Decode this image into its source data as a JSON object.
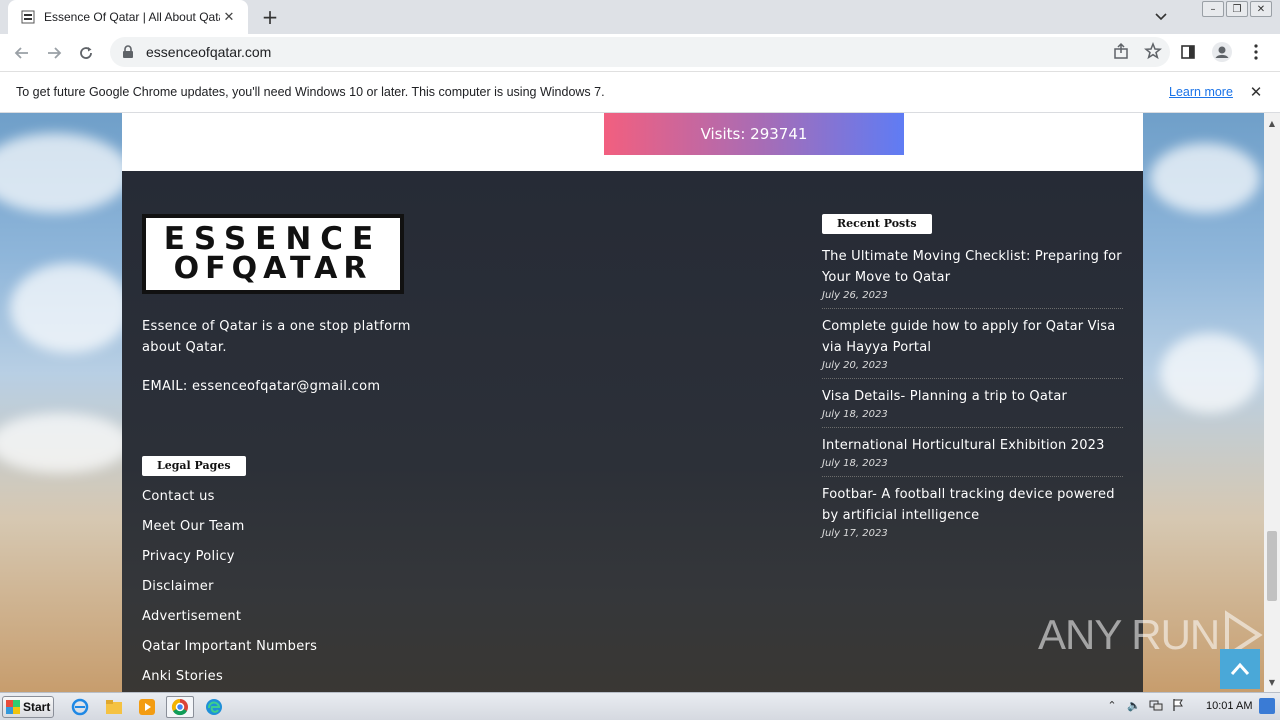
{
  "browser": {
    "tab_title": "Essence Of Qatar | All About Qatar",
    "url": "essenceofqatar.com",
    "infobar_text": "To get future Google Chrome updates, you'll need Windows 10 or later. This computer is using Windows 7.",
    "infobar_link": "Learn more"
  },
  "page": {
    "visits": "Visits: 293741",
    "footer": {
      "logo_line1": "ESSENCE",
      "logo_line2": "OFQATAR",
      "about": "Essence of Qatar is a one stop platform about Qatar.",
      "email": "EMAIL: essenceofqatar@gmail.com",
      "legal_title": "Legal Pages",
      "legal_links": [
        "Contact us",
        "Meet Our Team",
        "Privacy Policy",
        "Disclaimer",
        "Advertisement",
        "Qatar Important Numbers",
        "Anki Stories"
      ],
      "recent_title": "Recent Posts",
      "recent_posts": [
        {
          "title": "The Ultimate Moving Checklist: Preparing for Your Move to Qatar",
          "date": "July 26, 2023"
        },
        {
          "title": "Complete guide how to apply for Qatar Visa via Hayya Portal",
          "date": "July 20, 2023"
        },
        {
          "title": "Visa Details- Planning a trip to Qatar",
          "date": "July 18, 2023"
        },
        {
          "title": "International Horticultural Exhibition 2023",
          "date": "July 18, 2023"
        },
        {
          "title": "Footbar- A football tracking device powered by artificial intelligence",
          "date": "July 17, 2023"
        }
      ]
    },
    "watermark": "ANY RUN"
  },
  "taskbar": {
    "start_label": "Start",
    "clock": "10:01 AM"
  }
}
